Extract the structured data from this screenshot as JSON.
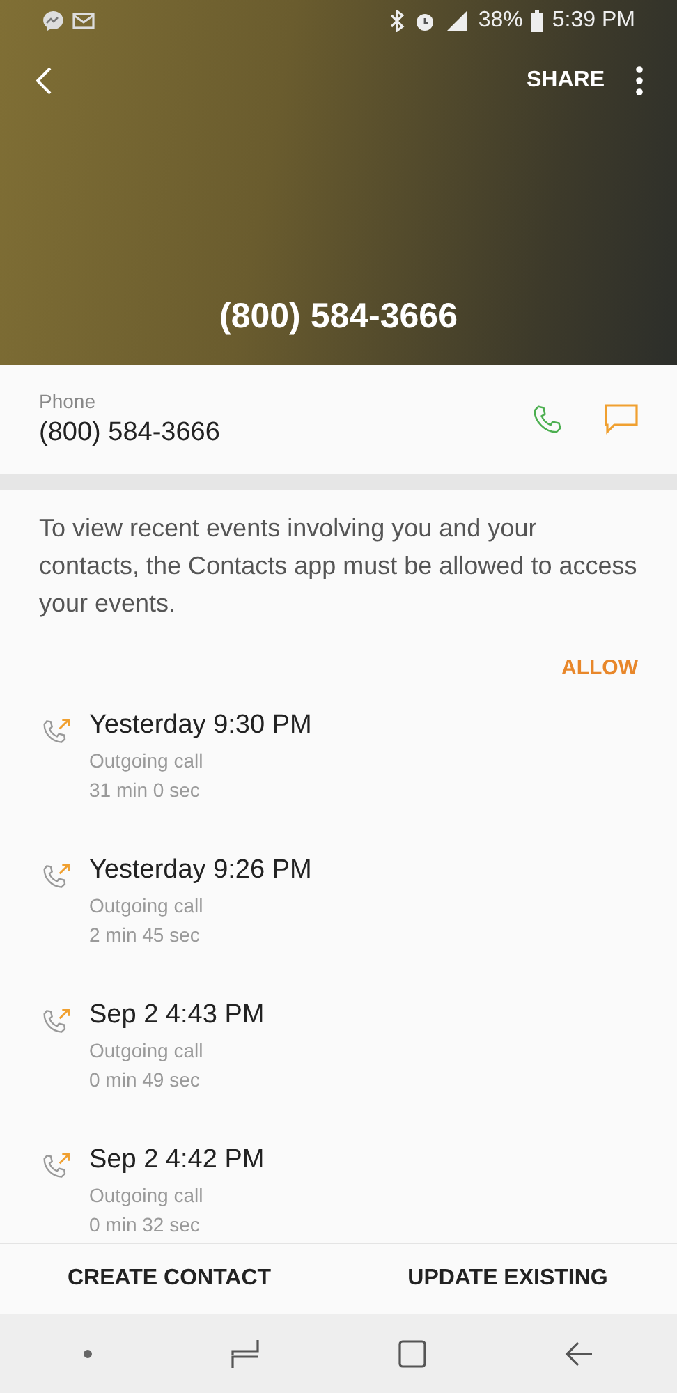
{
  "status_bar": {
    "battery": "38%",
    "time": "5:39 PM"
  },
  "header": {
    "share": "SHARE",
    "title": "(800) 584-3666"
  },
  "phone": {
    "label": "Phone",
    "number": "(800) 584-3666"
  },
  "notice": {
    "text": "To view recent events involving you and your contacts, the Contacts app must be allowed to access your events.",
    "action": "ALLOW"
  },
  "calls": [
    {
      "time": "Yesterday 9:30 PM",
      "type": "Outgoing call",
      "duration": "31 min 0 sec"
    },
    {
      "time": "Yesterday 9:26 PM",
      "type": "Outgoing call",
      "duration": "2 min 45 sec"
    },
    {
      "time": "Sep 2 4:43 PM",
      "type": "Outgoing call",
      "duration": "0 min 49 sec"
    },
    {
      "time": "Sep 2 4:42 PM",
      "type": "Outgoing call",
      "duration": "0 min 32 sec"
    }
  ],
  "buttons": [
    "CREATE CONTACT",
    "UPDATE EXISTING"
  ]
}
